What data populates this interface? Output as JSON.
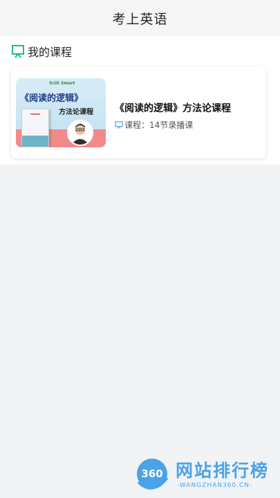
{
  "header": {
    "title": "考上英语"
  },
  "section": {
    "title": "我的课程",
    "icon": "board-icon"
  },
  "course": {
    "cover": {
      "brand": "Sciit Smart",
      "title": "《阅读的逻辑》",
      "subtitle": "方法论课程"
    },
    "title": "《阅读的逻辑》方法论课程",
    "meta": "课程：14节录播课"
  },
  "watermark": {
    "logo_text": "360",
    "text": "网站排行榜",
    "sub": "-WANGZHAN360.CN-"
  },
  "colors": {
    "accent": "#1dba8b",
    "watermark": "#4aa3e8"
  }
}
